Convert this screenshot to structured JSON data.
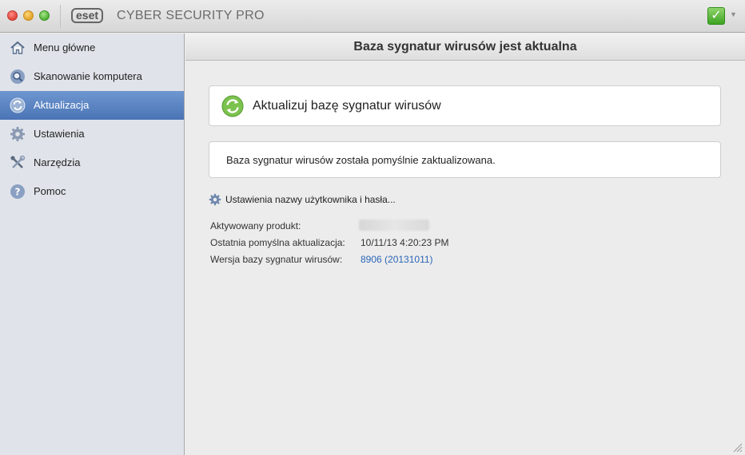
{
  "app": {
    "logo_text": "eset",
    "product_name": "CYBER SECURITY PRO",
    "status_icon": "check-icon",
    "status_color": "#4fb133"
  },
  "sidebar": {
    "items": [
      {
        "label": "Menu główne",
        "icon": "home-icon",
        "active": false
      },
      {
        "label": "Skanowanie komputera",
        "icon": "magnifier-icon",
        "active": false
      },
      {
        "label": "Aktualizacja",
        "icon": "refresh-icon",
        "active": true
      },
      {
        "label": "Ustawienia",
        "icon": "gear-icon",
        "active": false
      },
      {
        "label": "Narzędzia",
        "icon": "tools-icon",
        "active": false
      },
      {
        "label": "Pomoc",
        "icon": "help-icon",
        "active": false
      }
    ]
  },
  "main": {
    "header": "Baza sygnatur wirusów jest aktualna",
    "update_button_label": "Aktualizuj bazę sygnatur wirusów",
    "status_message": "Baza sygnatur wirusów została pomyślnie zaktualizowana.",
    "credentials_link": "Ustawienia nazwy użytkownika i hasła...",
    "info": {
      "activated_product_label": "Aktywowany produkt:",
      "last_update_label": "Ostatnia pomyślna aktualizacja:",
      "last_update_value": "10/11/13 4:20:23 PM",
      "db_version_label": "Wersja bazy sygnatur wirusów:",
      "db_version_value": "8906 (20131011)"
    }
  },
  "colors": {
    "accent": "#4a74b6",
    "link": "#2a66b8"
  }
}
